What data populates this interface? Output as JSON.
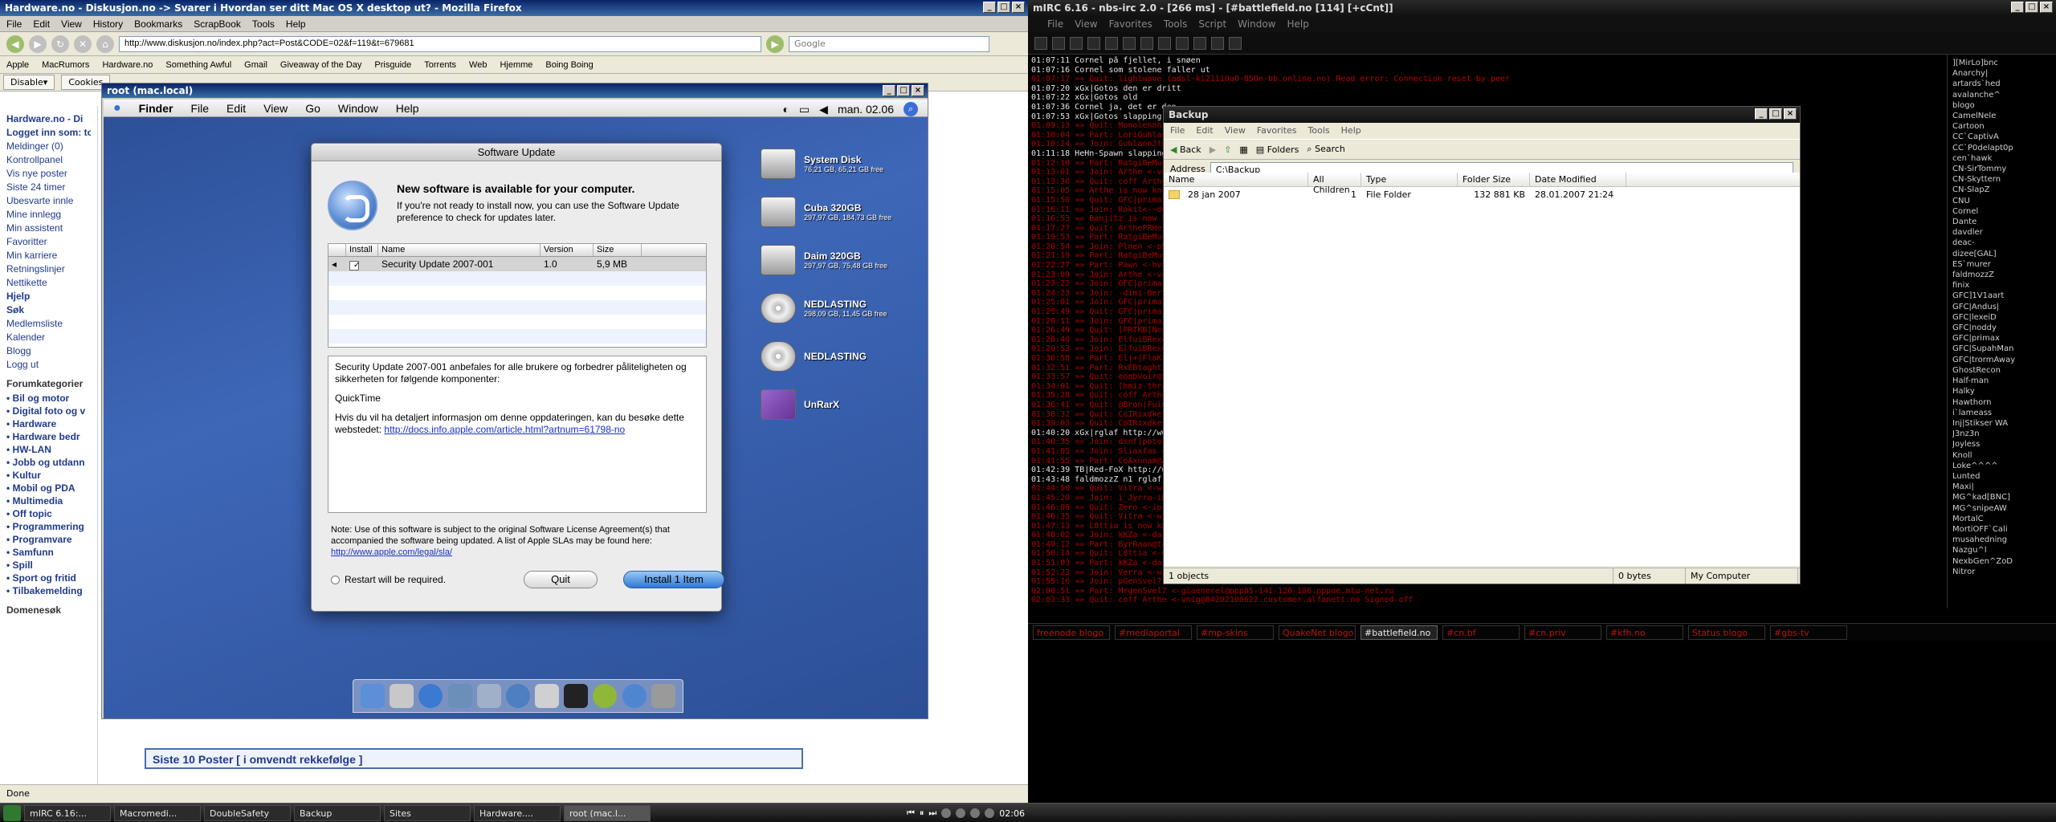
{
  "firefox": {
    "title": "Hardware.no - Diskusjon.no -> Svarer i Hvordan ser ditt Mac OS X desktop ut? - Mozilla Firefox",
    "menu": [
      "File",
      "Edit",
      "View",
      "History",
      "Bookmarks",
      "ScrapBook",
      "Tools",
      "Help"
    ],
    "url": "http://www.diskusjon.no/index.php?act=Post&CODE=02&f=119&t=679681",
    "search_placeholder": "Google",
    "bookmarks": [
      "Apple",
      "MacRumors",
      "Hardware.no",
      "Something Awful",
      "Gmail",
      "Giveaway of the Day",
      "Prisguide",
      "Torrents",
      "Web",
      "Hjemme",
      "Boing Boing"
    ],
    "tabs": [
      "Disable▾",
      "Cookies"
    ],
    "site_tab": "Hardware.no - Di",
    "sidebar": {
      "logged_in": "Logget inn som: tore",
      "links": [
        "Meldinger (0)",
        "Kontrollpanel",
        "Vis nye poster",
        "Siste 24 timer",
        "Ubesvarte innle",
        "Mine innlegg",
        "Min assistent",
        "Favoritter",
        "Min karriere",
        "Retningslinjer",
        "Nettikette",
        "Hjelp",
        "Søk",
        "Medlemsliste",
        "Kalender",
        "Blogg",
        "Logg ut"
      ],
      "cat_head": "Forumkategorier",
      "categories": [
        "• Bil og motor",
        "• Digital foto og v",
        "• Hardware",
        "• Hardware bedr",
        "• HW-LAN",
        "• Jobb og utdann",
        "• Kultur",
        "• Mobil og PDA",
        "• Multimedia",
        "• Off topic",
        "• Programmering",
        "• Programvare",
        "• Samfunn",
        "• Spill",
        "• Sport og fritid",
        "• Tilbakemelding"
      ],
      "domain_search": "Domenesøk"
    },
    "post_header": "Siste 10 Poster [ i omvendt rekkefølge ]",
    "status": "Done"
  },
  "vnc": {
    "title": "root (mac.local)",
    "mac_menu": [
      "Finder",
      "File",
      "Edit",
      "View",
      "Go",
      "Window",
      "Help"
    ],
    "clock": "man. 02.06",
    "software_update": {
      "title": "Software Update",
      "heading": "New software is available for your computer.",
      "subtext": "If you're not ready to install now, you can use the Software Update preference to check for updates later.",
      "columns": [
        "Install",
        "Name",
        "Version",
        "Size"
      ],
      "item": {
        "name": "Security Update 2007-001",
        "version": "1.0",
        "size": "5,9 MB",
        "checked": true
      },
      "desc_1": "Security Update 2007-001 anbefales for alle brukere og forbedrer påliteligheten og sikkerheten for følgende komponenter:",
      "desc_2": "QuickTime",
      "desc_3": "Hvis du vil ha detaljert informasjon om denne oppdateringen, kan du besøke dette webstedet:",
      "desc_link": "http://docs.info.apple.com/article.html?artnum=61798-no",
      "note": "Note: Use of this software is subject to the original Software License Agreement(s) that accompanied the software being updated. A list of Apple SLAs may be found here:",
      "note_link": "http://www.apple.com/legal/sla/",
      "restart": "Restart will be required.",
      "quit_label": "Quit",
      "install_label": "Install 1 Item"
    },
    "disks": [
      {
        "name": "System Disk",
        "size": "76,21 GB, 65,21 GB free"
      },
      {
        "name": "Cuba 320GB",
        "size": "297,97 GB, 184,73 GB free"
      },
      {
        "name": "Daim 320GB",
        "size": "297,97 GB, 75,48 GB free"
      },
      {
        "name": "NEDLASTING",
        "size": "298,09 GB, 11,45 GB free"
      },
      {
        "name": "NEDLASTING",
        "size": ""
      },
      {
        "name": "UnRarX",
        "size": ""
      }
    ]
  },
  "mirc": {
    "title": "mIRC 6.16 - nbs-irc 2.0 - [266 ms] - [#battlefield.no [114] [+cCnt]]",
    "menu": [
      "File",
      "View",
      "Favorites",
      "Tools",
      "Script",
      "Window",
      "Help"
    ],
    "lines": [
      {
        "t": "01:07:11  Cornel  på fjellet, i snøen",
        "c": "w"
      },
      {
        "t": "01:07:16  Cornel  som stolene faller ut",
        "c": "w"
      },
      {
        "t": "01:07:17 »» Quit: lightwave (adsl-ki21110a0-850n-bb.online.no) Read error: Connection reset by peer",
        "c": "r"
      },
      {
        "t": "01:07:20  xGx|Gotos  den er dritt",
        "c": "w"
      },
      {
        "t": "01:07:22  xGx|Gotos  old",
        "c": "w"
      },
      {
        "t": "01:07:36  Cornel  ja, det er den",
        "c": "w"
      },
      {
        "t": "01:07:53  xGx|Gotos  slapping m",
        "c": "w"
      },
      {
        "t": "01:09:13 »» Quit: MonolennhijamSp",
        "c": "r"
      },
      {
        "t": "01:10:04 »» Part: LoriGuhlannM",
        "c": "r"
      },
      {
        "t": "01:10:14 »» Join: GuhlannJtP",
        "c": "r"
      },
      {
        "t": "01:11:18  HeHn-Spawn  slapping",
        "c": "w"
      },
      {
        "t": "01:12:10 »» Part: RatgiBeMuurah",
        "c": "r"
      },
      {
        "t": "01:13:01 »» Join: Arthe <-vnig@",
        "c": "r"
      },
      {
        "t": "01:13:30 »» Quit: coff  Arthe <",
        "c": "r"
      },
      {
        "t": "01:15:05 »» Arthe is now known",
        "c": "r"
      },
      {
        "t": "01:15:50 »» Quit: GFC|primax <-",
        "c": "r"
      },
      {
        "t": "01:16:11 »» Join: Rokit<-~dwh",
        "c": "r"
      },
      {
        "t": "01:16:53 »» Banjitz is now known",
        "c": "r"
      },
      {
        "t": "01:17:27 »» Quit: ArthePRHerRy",
        "c": "r"
      },
      {
        "t": "01:19:53 »» Part: RatgiBeMuurah",
        "c": "r"
      },
      {
        "t": "01:20:54 »» Join: Plnen <-pha@",
        "c": "r"
      },
      {
        "t": "01:21:19 »» Part: RatgiBeMuurah",
        "c": "r"
      },
      {
        "t": "01:22:27 »» Part: Pawn <-hv8@",
        "c": "r"
      },
      {
        "t": "01:23:09 »» Join: Arthe <-vnig",
        "c": "r"
      },
      {
        "t": "01:23:22 »» Join: GFC|primax <-",
        "c": "r"
      },
      {
        "t": "01:24:23 »» Join: -dimi-Bert@",
        "c": "r"
      },
      {
        "t": "01:25:01 »» Join: GFC|primax <-",
        "c": "r"
      },
      {
        "t": "01:25:49 »» Quit: GFC|primax <-",
        "c": "r"
      },
      {
        "t": "01:26:11 »» Join: GFC|primax <-",
        "c": "r"
      },
      {
        "t": "01:26:49 »» Quit: [PRTKB]NeusS",
        "c": "r"
      },
      {
        "t": "01:28:40 »» Join: ElfuiBRexen",
        "c": "r"
      },
      {
        "t": "01:29:53 »» Join: ElfuiBRexenJ",
        "c": "r"
      },
      {
        "t": "01:30:58 »» Part: El|+|FlaKtem",
        "c": "r"
      },
      {
        "t": "01:32:51 »» Part: RxEBtaght",
        "c": "r"
      },
      {
        "t": "01:33:57 »» Quit: eonbvoir@S",
        "c": "r"
      },
      {
        "t": "01:34:01 »» Quit: [hmiz-thrcrin",
        "c": "r"
      },
      {
        "t": "01:35:28 »» Quit: coff  Arthe",
        "c": "r"
      },
      {
        "t": "01:36:41 »» Quit: @Bron|Fuinf",
        "c": "r"
      },
      {
        "t": "01:38:32 »» Quit: CoIRixdkesn",
        "c": "r"
      },
      {
        "t": "01:39:03 »» Quit: CoIRixdkesn",
        "c": "r"
      },
      {
        "t": "01:40:20  xGx|rglaf  http://www.",
        "c": "w"
      },
      {
        "t": "01:40:35 »» Join: dsnf|potoso <-",
        "c": "r"
      },
      {
        "t": "01:41:05 »» Join: Sliaxfas <-GA",
        "c": "r"
      },
      {
        "t": "01:41:55 »» Part: CoAxnnam@A",
        "c": "r"
      },
      {
        "t": "01:42:39  TB|Red-FoX  http://ww",
        "c": "w"
      },
      {
        "t": "01:43:48  faldmozzZ  n1 rglaf ;D",
        "c": "w"
      },
      {
        "t": "01:44:50 »» Quit: Vitra <-wr@ul",
        "c": "r"
      },
      {
        "t": "01:45:20 »» Join: i_Jyrra-iKtLOL",
        "c": "r"
      },
      {
        "t": "01:46:06 »» Quit: Zero <-ipl@",
        "c": "r"
      },
      {
        "t": "01:46:35 »» Quit: Vitra <-wr@ul",
        "c": "r"
      },
      {
        "t": "01:47:13 »» L8ttia is now known",
        "c": "r"
      },
      {
        "t": "01:48:02 »» Join: kKZa <-dacie@",
        "c": "r"
      },
      {
        "t": "01:49:12 »» Part: ByrRaan@tanz",
        "c": "r"
      },
      {
        "t": "01:50:14 »» Quit: L8ttia <-Contra",
        "c": "r"
      },
      {
        "t": "01:51:03 »» Part: kKZa <-dacie@",
        "c": "r"
      },
      {
        "t": "01:52:23 »» Join: Verra <-wr@ul",
        "c": "r"
      },
      {
        "t": "01:55:16 »» Join: pGenSvel7 <-",
        "c": "r"
      },
      {
        "t": "02:00:51 »» Part: MrgenSvel7 <-glaenerel@ppp85-141-126-186.pppoe.mtu-net.ru",
        "c": "r"
      },
      {
        "t": "02:02:33 »» Quit: coff  Arthe <-vnig@84202100622.customer.alfanett.no  Signed off",
        "c": "r"
      }
    ],
    "nicks": [
      "][MirLo]bnc",
      "Anarchy|",
      "artards`hed",
      "avalanche^",
      "blogo",
      "CamelNele",
      "Cartoon",
      "CC`CaptivA",
      "CC`P0delapt0p",
      "cen`hawk",
      "CN-SirTommy",
      "CN-Skyttern",
      "CN-SlapZ",
      "CNU",
      "Cornel",
      "Dante",
      "davdler",
      "deac-",
      "dizee[GAL]",
      "ES`murer",
      "faldmozzZ",
      "finix",
      "GFC]1V1aart",
      "GFC|Andus|",
      "GFC|lexeiD",
      "GFC|noddy",
      "GFC|primax",
      "GFC|SupahMan",
      "GFC|trormAway",
      "GhostRecon",
      "Half-man",
      "Halky",
      "Hawthorn",
      "i`lameass",
      "Inj|Stikser WA",
      "J3nz3n",
      "Joyless",
      "Knoll",
      "Loke^^^^",
      "Lunted",
      "Maxi|",
      "MG^kad[BNC]",
      "MG^snipeAW",
      "MortalC",
      "MortiOFF`Cali",
      "musahedning",
      "Nazgu^l",
      "NexbGen^ZoD",
      "Nitror"
    ],
    "switchbar": [
      "freenode blogo",
      "#mediaportal",
      "#mp-skins",
      "QuakeNet blogo",
      "#battlefield.no",
      "#cn.bf",
      "#cn.priv",
      "#kfh.no",
      "Status blogo",
      "#gbs-tv"
    ]
  },
  "explorer": {
    "title": "Backup",
    "menu": [
      "File",
      "Edit",
      "View",
      "Favorites",
      "Tools",
      "Help"
    ],
    "toolbar": [
      "Back",
      "Folders",
      "Search"
    ],
    "address_label": "Address",
    "address": "C:\\Backup",
    "columns": [
      "Name",
      "All Children",
      "Type",
      "Folder Size",
      "Date Modified"
    ],
    "row": {
      "name": "28 jan 2007",
      "children": "1",
      "type": "File Folder",
      "size": "132 881 KB",
      "modified": "28.01.2007 21:24"
    },
    "status_objects": "1 objects",
    "status_bytes": "0 bytes",
    "status_location": "My Computer"
  },
  "taskbar_left": [
    "mIRC 6.16:...",
    "Macromedi...",
    "DoubleSafety",
    "Backup",
    "Sites",
    "Hardware....",
    "root (mac.l..."
  ],
  "clock": "02:06"
}
